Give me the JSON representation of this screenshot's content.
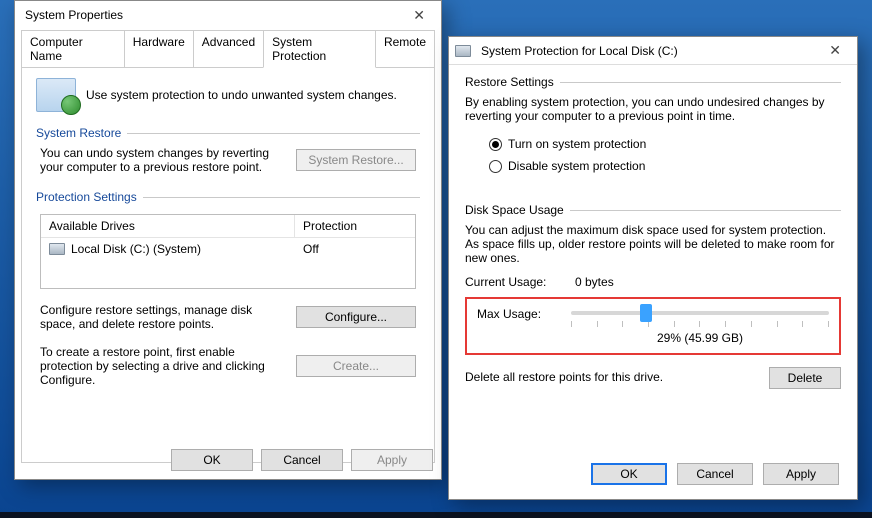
{
  "window1": {
    "title": "System Properties",
    "tabs": [
      "Computer Name",
      "Hardware",
      "Advanced",
      "System Protection",
      "Remote"
    ],
    "activeTab": 3,
    "intro": "Use system protection to undo unwanted system changes.",
    "systemRestore": {
      "header": "System Restore",
      "text": "You can undo system changes by reverting your computer to a previous restore point.",
      "button": "System Restore..."
    },
    "protectionSettings": {
      "header": "Protection Settings",
      "columns": [
        "Available Drives",
        "Protection"
      ],
      "rows": [
        {
          "drive": "Local Disk (C:) (System)",
          "protection": "Off"
        }
      ],
      "configureText": "Configure restore settings, manage disk space, and delete restore points.",
      "configureButton": "Configure...",
      "createText": "To create a restore point, first enable protection by selecting a drive and clicking Configure.",
      "createButton": "Create..."
    },
    "buttons": {
      "ok": "OK",
      "cancel": "Cancel",
      "apply": "Apply"
    }
  },
  "window2": {
    "title": "System Protection for Local Disk (C:)",
    "restoreSettings": {
      "header": "Restore Settings",
      "text": "By enabling system protection, you can undo undesired changes by reverting your computer to a previous point in time.",
      "optionOn": "Turn on system protection",
      "optionOff": "Disable system protection",
      "selected": "on"
    },
    "diskSpace": {
      "header": "Disk Space Usage",
      "text": "You can adjust the maximum disk space used for system protection. As space fills up, older restore points will be deleted to make room for new ones.",
      "currentUsageLabel": "Current Usage:",
      "currentUsageValue": "0 bytes",
      "maxUsageLabel": "Max Usage:",
      "sliderPercent": 29,
      "sliderCaption": "29% (45.99 GB)"
    },
    "deleteText": "Delete all restore points for this drive.",
    "deleteButton": "Delete",
    "buttons": {
      "ok": "OK",
      "cancel": "Cancel",
      "apply": "Apply"
    }
  }
}
